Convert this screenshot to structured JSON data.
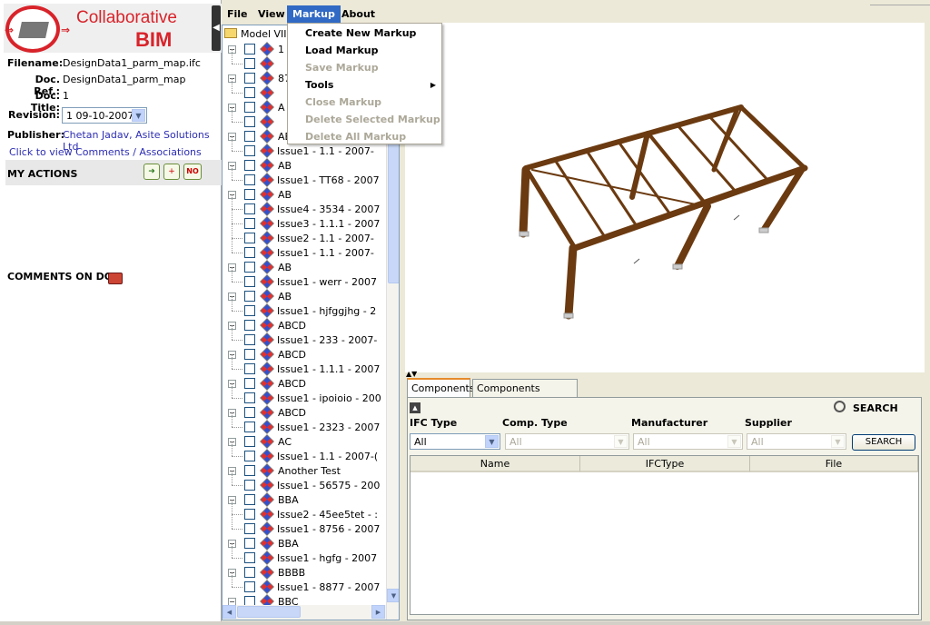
{
  "app": {
    "logo_line1": "Collaborative",
    "logo_line2": "BIM"
  },
  "doc": {
    "filename_label": "Filename:",
    "filename": "DesignData1_parm_map.ifc",
    "ref_label": "Doc. Ref.:",
    "ref": "DesignData1_parm_map",
    "title_label": "Doc. Title:",
    "title": "1",
    "revision_label": "Revision:",
    "revision": "1 09-10-2007",
    "publisher_label": "Publisher:",
    "publisher": "Chetan Jadav, Asite Solutions Ltd",
    "comments_link": "Click to view Comments / Associations"
  },
  "sections": {
    "my_actions": "MY ACTIONS",
    "comments_on_doc": "COMMENTS ON DOC",
    "no_badge": "NO"
  },
  "menubar": {
    "file": "File",
    "view": "View",
    "markup": "Markup",
    "about": "About"
  },
  "markup_menu": [
    {
      "label": "Create New Markup",
      "enabled": true
    },
    {
      "label": "Load Markup",
      "enabled": true
    },
    {
      "label": "Save Markup",
      "enabled": false
    },
    {
      "label": "Tools",
      "enabled": true,
      "submenu": true
    },
    {
      "label": "Close Markup",
      "enabled": false
    },
    {
      "label": "Delete Selected Markup",
      "enabled": false
    },
    {
      "label": "Delete All Markup",
      "enabled": false
    }
  ],
  "tree": {
    "root": "Model VIII",
    "rows": [
      {
        "level": 0,
        "label": "1"
      },
      {
        "level": 1,
        "label": ""
      },
      {
        "level": 0,
        "label": "87"
      },
      {
        "level": 1,
        "label": ""
      },
      {
        "level": 0,
        "label": "A"
      },
      {
        "level": 1,
        "label": ""
      },
      {
        "level": 0,
        "label": "AB"
      },
      {
        "level": 1,
        "label": "Issue1 - 1.1 - 2007-"
      },
      {
        "level": 0,
        "label": "AB"
      },
      {
        "level": 1,
        "label": "Issue1 - TT68 - 2007"
      },
      {
        "level": 0,
        "label": "AB"
      },
      {
        "level": 1,
        "label": "Issue4 - 3534 - 2007"
      },
      {
        "level": 1,
        "label": "Issue3 - 1.1.1 - 2007"
      },
      {
        "level": 1,
        "label": "Issue2 - 1.1 - 2007-"
      },
      {
        "level": 1,
        "label": "Issue1 - 1.1 - 2007-"
      },
      {
        "level": 0,
        "label": "AB"
      },
      {
        "level": 1,
        "label": "Issue1 - werr - 2007"
      },
      {
        "level": 0,
        "label": "AB"
      },
      {
        "level": 1,
        "label": "Issue1 - hjfggjhg - 2"
      },
      {
        "level": 0,
        "label": "ABCD"
      },
      {
        "level": 1,
        "label": "Issue1 - 233 - 2007-"
      },
      {
        "level": 0,
        "label": "ABCD"
      },
      {
        "level": 1,
        "label": "Issue1 - 1.1.1 - 2007"
      },
      {
        "level": 0,
        "label": "ABCD"
      },
      {
        "level": 1,
        "label": "Issue1 - ipoioio - 200"
      },
      {
        "level": 0,
        "label": "ABCD"
      },
      {
        "level": 1,
        "label": "Issue1 - 2323 - 2007"
      },
      {
        "level": 0,
        "label": "AC"
      },
      {
        "level": 1,
        "label": "Issue1 - 1.1 - 2007-("
      },
      {
        "level": 0,
        "label": "Another Test"
      },
      {
        "level": 1,
        "label": "Issue1 - 56575 - 200"
      },
      {
        "level": 0,
        "label": "BBA"
      },
      {
        "level": 1,
        "label": "Issue2 - 45ee5tet - :"
      },
      {
        "level": 1,
        "label": "Issue1 - 8756 - 2007"
      },
      {
        "level": 0,
        "label": "BBA"
      },
      {
        "level": 1,
        "label": "Issue1 - hgfg - 2007"
      },
      {
        "level": 0,
        "label": "BBBB"
      },
      {
        "level": 1,
        "label": "Issue1 - 8877 - 2007"
      },
      {
        "level": 0,
        "label": "BBC"
      }
    ]
  },
  "bottom": {
    "tabs": [
      "Components",
      "Components Summary"
    ],
    "search_header": "SEARCH",
    "filters": [
      {
        "label": "IFC Type",
        "value": "All",
        "enabled": true
      },
      {
        "label": "Comp. Type",
        "value": "All",
        "enabled": false
      },
      {
        "label": "Manufacturer",
        "value": "All",
        "enabled": false
      },
      {
        "label": "Supplier",
        "value": "All",
        "enabled": false
      }
    ],
    "search_button": "SEARCH",
    "columns": [
      "Name",
      "IFCType",
      "File"
    ]
  },
  "colors": {
    "brand_red": "#d8232a",
    "menu_highlight": "#316ac5",
    "beam_brown": "#6b3a10",
    "link_blue": "#2c2cb3"
  }
}
